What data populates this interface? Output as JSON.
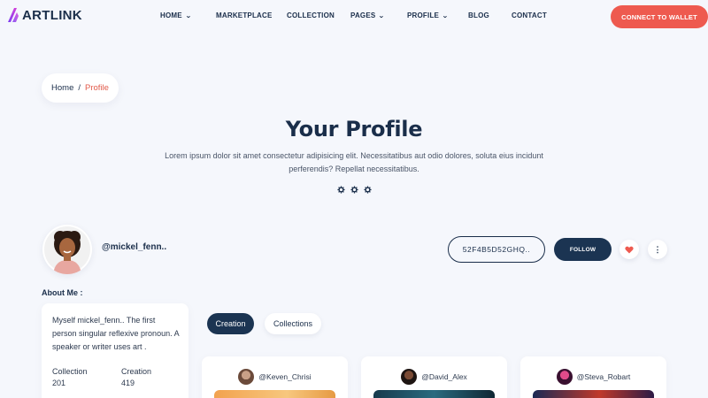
{
  "header": {
    "logo": "ARTLINK",
    "nav": [
      {
        "label": "HOME",
        "dropdown": true
      },
      {
        "label": "MARKETPLACE",
        "dropdown": false
      },
      {
        "label": "COLLECTION",
        "dropdown": false
      },
      {
        "label": "PAGES",
        "dropdown": true
      },
      {
        "label": "PROFILE",
        "dropdown": true
      },
      {
        "label": "BLOG",
        "dropdown": false
      },
      {
        "label": "CONTACT",
        "dropdown": false
      }
    ],
    "connect_label": "CONNECT TO WALLET"
  },
  "breadcrumb": {
    "home": "Home",
    "separator": "/",
    "current": "Profile"
  },
  "hero": {
    "title": "Your Profile",
    "description": "Lorem ipsum dolor sit amet consectetur adipisicing elit. Necessitatibus aut odio dolores, soluta eius incidunt perferendis? Repellat necessitatibus."
  },
  "profile": {
    "username": "@mickel_fenn..",
    "hash": "52F4B5D52GHQ..",
    "follow_label": "FOLLOW",
    "more_glyph": "⋮"
  },
  "about": {
    "title": "About Me :",
    "text": "Myself mickel_fenn.. The first person singular reflexive pronoun. A speaker or writer uses art .",
    "stats": [
      {
        "label": "Collection",
        "value": "201"
      },
      {
        "label": "Creation",
        "value": "419"
      }
    ]
  },
  "tabs": [
    {
      "label": "Creation",
      "active": true
    },
    {
      "label": "Collections",
      "active": false
    }
  ],
  "cards": [
    {
      "user": "@Keven_Chrisi"
    },
    {
      "user": "@David_Alex"
    },
    {
      "user": "@Steva_Robart"
    }
  ],
  "colors": {
    "accent": "#ee5a4f",
    "navy": "#1b3452",
    "background": "#f5f7fc",
    "logo_gradient": [
      "#7b3ff2",
      "#d63fd9"
    ]
  },
  "icons": [
    "logo-icon",
    "chevron-down-icon",
    "gear-icon",
    "heart-icon",
    "more-vertical-icon"
  ]
}
